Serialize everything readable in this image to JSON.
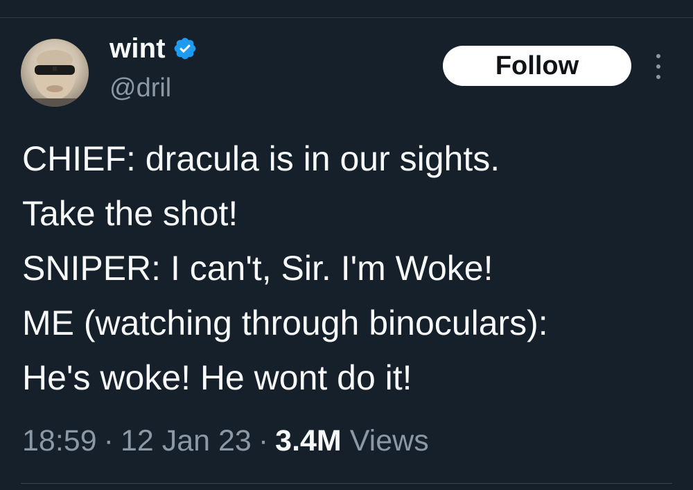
{
  "author": {
    "display_name": "wint",
    "handle": "@dril",
    "verified": true,
    "verified_color": "#1d9bf0",
    "avatar_icon": "user-avatar-photo"
  },
  "actions": {
    "follow_label": "Follow",
    "more_icon": "more-vertical-icon"
  },
  "tweet": {
    "lines": [
      "CHIEF: dracula is in our sights.",
      "Take the shot!",
      "SNIPER: I can't, Sir. I'm Woke!",
      "ME (watching through binoculars):",
      "He's woke! He wont do it!"
    ]
  },
  "meta": {
    "time": "18:59",
    "separator": "·",
    "date": "12 Jan 23",
    "views_count": "3.4M",
    "views_label": "Views"
  },
  "colors": {
    "background": "#15202b",
    "text_primary": "#f7f9f9",
    "text_secondary": "#8b98a5",
    "follow_bg": "#ffffff",
    "follow_text": "#0f1419"
  }
}
